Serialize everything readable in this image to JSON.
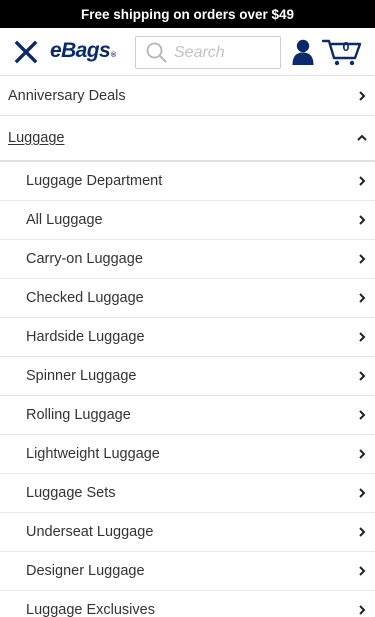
{
  "promo": {
    "text": "Free shipping on orders over $49"
  },
  "header": {
    "logo_text": "eBags",
    "logo_mark": "®",
    "search_placeholder": "Search",
    "cart_count": "0",
    "icons": [
      "close-icon",
      "search-icon",
      "user-icon",
      "cart-icon"
    ]
  },
  "colors": {
    "brand_navy": "#0b2a6b",
    "promo_bg": "#000000",
    "divider": "#e6e6e6"
  },
  "menu": {
    "top_items": [
      {
        "label": "Anniversary Deals",
        "state": "collapsed"
      },
      {
        "label": "Luggage",
        "state": "expanded"
      }
    ],
    "luggage_sub": [
      {
        "label": "Luggage Department"
      },
      {
        "label": "All Luggage"
      },
      {
        "label": "Carry-on Luggage"
      },
      {
        "label": "Checked Luggage"
      },
      {
        "label": "Hardside Luggage"
      },
      {
        "label": "Spinner Luggage"
      },
      {
        "label": "Rolling Luggage"
      },
      {
        "label": "Lightweight Luggage"
      },
      {
        "label": "Luggage Sets"
      },
      {
        "label": "Underseat Luggage"
      },
      {
        "label": "Designer Luggage"
      },
      {
        "label": "Luggage Exclusives"
      }
    ]
  }
}
